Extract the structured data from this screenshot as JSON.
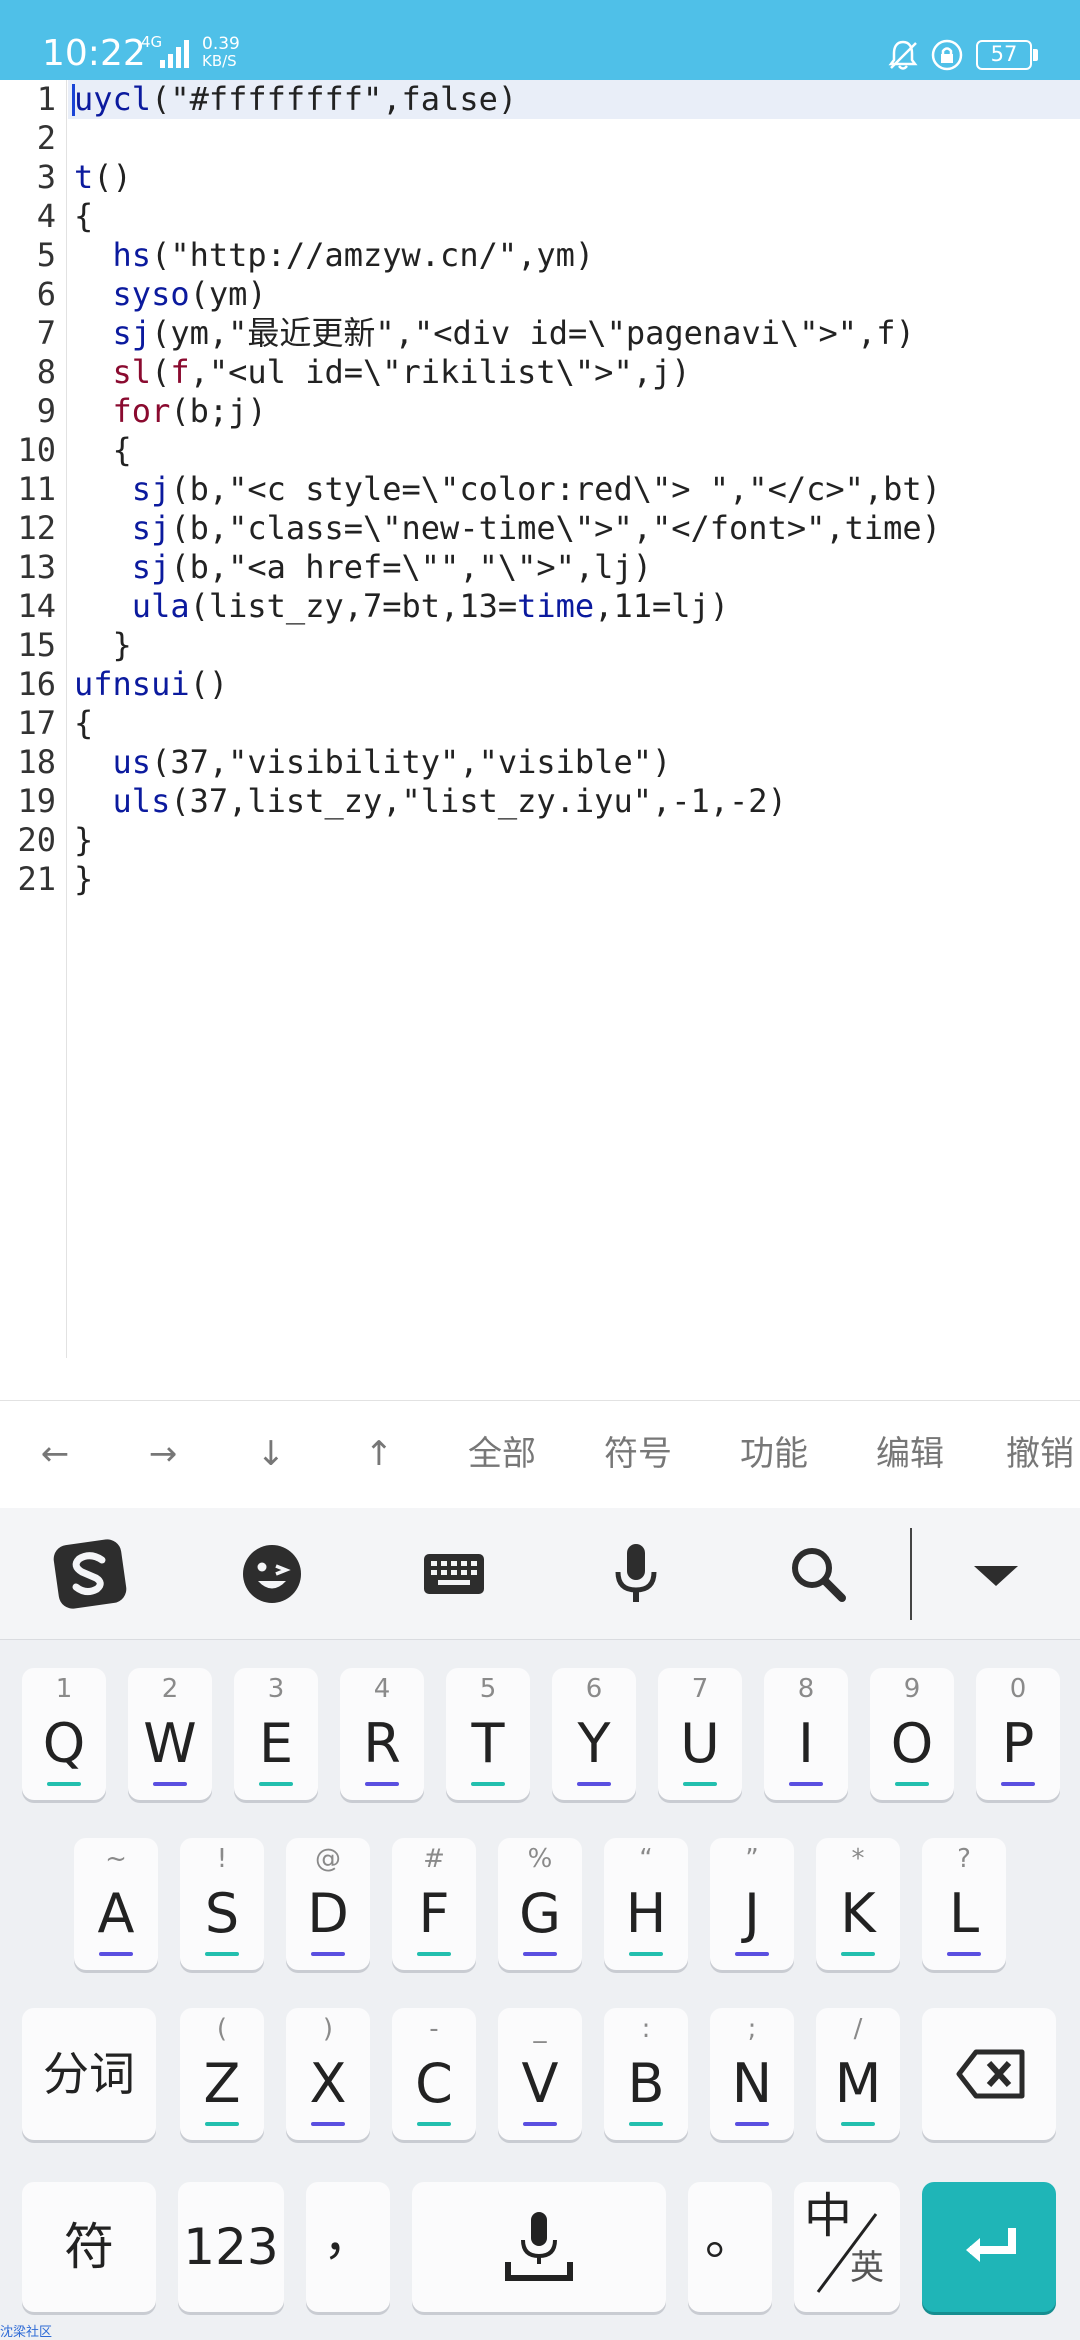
{
  "status_bar": {
    "time": "10:22",
    "network": "4G",
    "speed_value": "0.39",
    "speed_unit": "KB/S",
    "battery": "57"
  },
  "editor": {
    "line_numbers": [
      "1",
      "2",
      "3",
      "4",
      "5",
      "6",
      "7",
      "8",
      "9",
      "10",
      "11",
      "12",
      "13",
      "14",
      "15",
      "16",
      "17",
      "18",
      "19",
      "20",
      "21"
    ],
    "lines": [
      [
        {
          "t": "uycl",
          "c": "kw"
        },
        {
          "t": "(\"#ffffffff\",false)",
          "c": "str"
        }
      ],
      [],
      [
        {
          "t": "t",
          "c": "kw"
        },
        {
          "t": "()",
          "c": "var"
        }
      ],
      [
        {
          "t": "{",
          "c": "var"
        }
      ],
      [
        {
          "t": "  ",
          "c": "var"
        },
        {
          "t": "hs",
          "c": "kw"
        },
        {
          "t": "(\"http://amzyw.cn/\",ym)",
          "c": "str"
        }
      ],
      [
        {
          "t": "  ",
          "c": "var"
        },
        {
          "t": "syso",
          "c": "kw"
        },
        {
          "t": "(ym)",
          "c": "var"
        }
      ],
      [
        {
          "t": "  ",
          "c": "var"
        },
        {
          "t": "sj",
          "c": "kw"
        },
        {
          "t": "(ym,\"最近更新\",\"<div id=\\\"pagenavi\\\">\",f)",
          "c": "str"
        }
      ],
      [
        {
          "t": "  ",
          "c": "var"
        },
        {
          "t": "sl",
          "c": "kw2"
        },
        {
          "t": "(",
          "c": "var"
        },
        {
          "t": "f",
          "c": "kw2"
        },
        {
          "t": ",\"<ul id=\\\"rikilist\\\">\",j)",
          "c": "str"
        }
      ],
      [
        {
          "t": "  ",
          "c": "var"
        },
        {
          "t": "for",
          "c": "kw2"
        },
        {
          "t": "(b;j)",
          "c": "var"
        }
      ],
      [
        {
          "t": "  {",
          "c": "var"
        }
      ],
      [
        {
          "t": "   ",
          "c": "var"
        },
        {
          "t": "sj",
          "c": "kw"
        },
        {
          "t": "(b,\"<c style=\\\"color:red\\\"> \",\"</c>\",bt)",
          "c": "str"
        }
      ],
      [
        {
          "t": "   ",
          "c": "var"
        },
        {
          "t": "sj",
          "c": "kw"
        },
        {
          "t": "(b,\"class=\\\"new-time\\\">\",\"</font>\",time)",
          "c": "str"
        }
      ],
      [
        {
          "t": "   ",
          "c": "var"
        },
        {
          "t": "sj",
          "c": "kw"
        },
        {
          "t": "(b,\"<a href=\\\"\",\"\\\">\",lj)",
          "c": "str"
        }
      ],
      [
        {
          "t": "   ",
          "c": "var"
        },
        {
          "t": "ula",
          "c": "kw"
        },
        {
          "t": "(list_zy,7=bt,13=",
          "c": "var"
        },
        {
          "t": "time",
          "c": "kw"
        },
        {
          "t": ",11=lj)",
          "c": "var"
        }
      ],
      [
        {
          "t": "  }",
          "c": "var"
        }
      ],
      [
        {
          "t": "ufnsui",
          "c": "kw"
        },
        {
          "t": "()",
          "c": "var"
        }
      ],
      [
        {
          "t": "{",
          "c": "var"
        }
      ],
      [
        {
          "t": "  ",
          "c": "var"
        },
        {
          "t": "us",
          "c": "kw"
        },
        {
          "t": "(37,\"visibility\",\"visible\")",
          "c": "str"
        }
      ],
      [
        {
          "t": "  ",
          "c": "var"
        },
        {
          "t": "uls",
          "c": "kw"
        },
        {
          "t": "(37,list_zy,\"list_zy.iyu\",-1,-2)",
          "c": "str"
        }
      ],
      [
        {
          "t": "}",
          "c": "var"
        }
      ],
      [
        {
          "t": "}",
          "c": "var"
        }
      ]
    ]
  },
  "toolbar": {
    "left": "←",
    "right": "→",
    "down": "↓",
    "up": "↑",
    "all": "全部",
    "symbol": "符号",
    "function": "功能",
    "edit": "编辑",
    "undo": "撤销"
  },
  "ime_bar": {
    "icons": [
      "sogou-logo-icon",
      "emoji-icon",
      "keyboard-icon",
      "microphone-icon",
      "search-icon",
      "collapse-icon"
    ]
  },
  "keyboard": {
    "row1": [
      {
        "hint": "1",
        "key": "Q",
        "bar": "t"
      },
      {
        "hint": "2",
        "key": "W",
        "bar": "b"
      },
      {
        "hint": "3",
        "key": "E",
        "bar": "t"
      },
      {
        "hint": "4",
        "key": "R",
        "bar": "b"
      },
      {
        "hint": "5",
        "key": "T",
        "bar": "t"
      },
      {
        "hint": "6",
        "key": "Y",
        "bar": "b"
      },
      {
        "hint": "7",
        "key": "U",
        "bar": "t"
      },
      {
        "hint": "8",
        "key": "I",
        "bar": "b"
      },
      {
        "hint": "9",
        "key": "O",
        "bar": "t"
      },
      {
        "hint": "0",
        "key": "P",
        "bar": "b"
      }
    ],
    "row2": [
      {
        "hint": "~",
        "key": "A",
        "bar": "b"
      },
      {
        "hint": "!",
        "key": "S",
        "bar": "t"
      },
      {
        "hint": "@",
        "key": "D",
        "bar": "b"
      },
      {
        "hint": "#",
        "key": "F",
        "bar": "t"
      },
      {
        "hint": "%",
        "key": "G",
        "bar": "b"
      },
      {
        "hint": "“",
        "key": "H",
        "bar": "t"
      },
      {
        "hint": "”",
        "key": "J",
        "bar": "b"
      },
      {
        "hint": "*",
        "key": "K",
        "bar": "t"
      },
      {
        "hint": "?",
        "key": "L",
        "bar": "b"
      }
    ],
    "row3": [
      {
        "hint": "(",
        "key": "Z",
        "bar": "t"
      },
      {
        "hint": ")",
        "key": "X",
        "bar": "b"
      },
      {
        "hint": "-",
        "key": "C",
        "bar": "t"
      },
      {
        "hint": "_",
        "key": "V",
        "bar": "b"
      },
      {
        "hint": ":",
        "key": "B",
        "bar": "t"
      },
      {
        "hint": ";",
        "key": "N",
        "bar": "b"
      },
      {
        "hint": "/",
        "key": "M",
        "bar": "t"
      }
    ],
    "segment": "分词",
    "symbols": "符",
    "numbers": "123",
    "comma": "，",
    "period": "。",
    "lang_zh": "中",
    "lang_en": "英"
  },
  "watermark": "沈梁社区"
}
